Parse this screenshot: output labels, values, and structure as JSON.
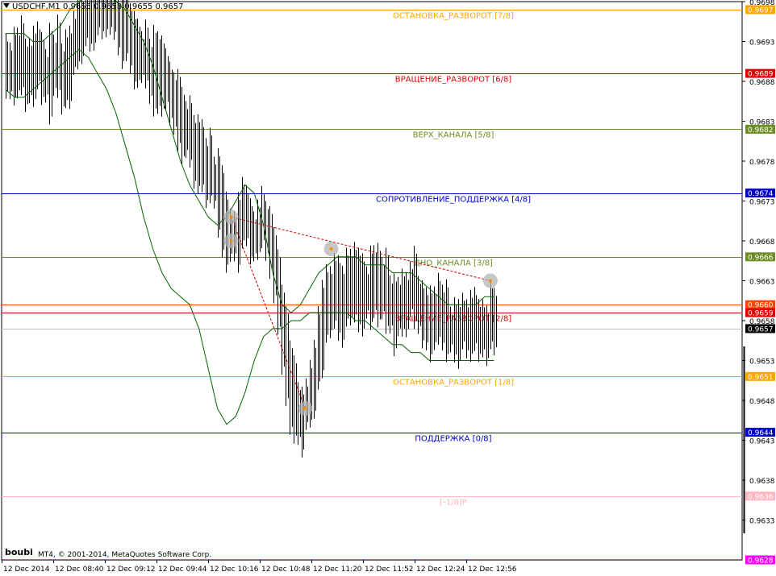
{
  "header": {
    "symbol_info": "USDCHF,M1  0.9655 0.9658 0.9655 0.9657"
  },
  "footer": {
    "user": "boubi",
    "copyright": "MT4, © 2001-2014, MetaQuotes Software Corp."
  },
  "colors": {
    "candle": "#000000",
    "bollinger": "#006400",
    "trendline": "#cc0000",
    "axis": "#000000",
    "grid_text": "#000000",
    "marker": "#b4b4b4"
  },
  "chart_data": {
    "type": "candlestick",
    "title": "USDCHF,M1",
    "ohlc_header": [
      "0.9655",
      "0.9658",
      "0.9655",
      "0.9657"
    ],
    "ylim": [
      0.9628,
      0.9698
    ],
    "price_ticks": [
      "0.9698",
      "0.9693",
      "0.9688",
      "0.9683",
      "0.9678",
      "0.9673",
      "0.9668",
      "0.9663",
      "0.9658",
      "0.9653",
      "0.9648",
      "0.9643",
      "0.9638",
      "0.9633"
    ],
    "time_ticks": [
      "12 Dec 2014",
      "12 Dec 08:40",
      "12 Dec 09:12",
      "12 Dec 09:44",
      "12 Dec 10:16",
      "12 Dec 10:48",
      "12 Dec 11:20",
      "12 Dec 11:52",
      "12 Dec 12:24",
      "12 Dec 12:56"
    ],
    "current_price": {
      "value": 0.9657,
      "label": "0.9657"
    },
    "levels": [
      {
        "name": "ОСТАНОВКА_РАЗВОРОТ [7/8]",
        "value": 0.9697,
        "label": "0.9697",
        "color": "#ffa500"
      },
      {
        "name": "ВРАЩЕНИЕ_РАЗВОРОТ [6/8]",
        "value": 0.9689,
        "label": "0.9689",
        "color": "#e00000"
      },
      {
        "name": "ВЕРХ_КАНАЛА [5/8]",
        "value": 0.9682,
        "label": "0.9682",
        "color": "#6b8e23"
      },
      {
        "name": "СОПРОТИВЛЕНИЕ_ПОДДЕРЖКА [4/8]",
        "value": 0.9674,
        "label": "0.9674",
        "color": "#0000cd"
      },
      {
        "name": "ДНО_КАНАЛА [3/8]",
        "value": 0.9666,
        "label": "0.9666",
        "color": "#6b8e23"
      },
      {
        "name": "",
        "value": 0.966,
        "label": "0.9660",
        "color": "#ff4500"
      },
      {
        "name": "ВРАЩЕНИЕ_РАЗВОРОТ [2/8]",
        "value": 0.9659,
        "label": "0.9659",
        "color": "#e00000"
      },
      {
        "name": "ОСТАНОВКА_РАЗВОРОТ [1/8]",
        "value": 0.9651,
        "label": "0.9651",
        "color": "#ffa500"
      },
      {
        "name": "ПОДДЕРЖКА [0/8]",
        "value": 0.9644,
        "label": "0.9644",
        "color": "#0000cd"
      },
      {
        "name": "[-1/8]P",
        "value": 0.9636,
        "label": "0.9636",
        "color": "#ffb6c1"
      },
      {
        "name": "",
        "value": 0.9628,
        "label": "0.9628",
        "color": "#ff00ff"
      }
    ],
    "price_line": [
      0.969,
      0.9689,
      0.9691,
      0.9692,
      0.969,
      0.9689,
      0.9688,
      0.9691,
      0.969,
      0.9689,
      0.9688,
      0.969,
      0.9691,
      0.9689,
      0.9688,
      0.969,
      0.9692,
      0.9693,
      0.9695,
      0.9696,
      0.9697,
      0.9697,
      0.9698,
      0.9697,
      0.9698,
      0.9698,
      0.9697,
      0.9696,
      0.9695,
      0.9694,
      0.9694,
      0.9693,
      0.9692,
      0.9691,
      0.9691,
      0.969,
      0.969,
      0.9689,
      0.9689,
      0.9688,
      0.9687,
      0.9686,
      0.9685,
      0.9684,
      0.9683,
      0.9682,
      0.9681,
      0.968,
      0.9679,
      0.9678,
      0.9677,
      0.9676,
      0.9675,
      0.9673,
      0.9671,
      0.9669,
      0.9668,
      0.9669,
      0.967,
      0.9671,
      0.967,
      0.9669,
      0.9669,
      0.967,
      0.967,
      0.9668,
      0.9666,
      0.9663,
      0.966,
      0.9656,
      0.9652,
      0.9649,
      0.9647,
      0.9646,
      0.9647,
      0.9648,
      0.965,
      0.9653,
      0.9656,
      0.9659,
      0.9661,
      0.9662,
      0.9661,
      0.966,
      0.9661,
      0.9662,
      0.9663,
      0.9663,
      0.9662,
      0.9661,
      0.9661,
      0.9662,
      0.9663,
      0.9662,
      0.9662,
      0.9661,
      0.966,
      0.9659,
      0.9659,
      0.966,
      0.9661,
      0.9662,
      0.9661,
      0.966,
      0.9659,
      0.9659,
      0.9658,
      0.9658,
      0.9659,
      0.9658,
      0.9657,
      0.9657,
      0.9656,
      0.9657,
      0.9658,
      0.9658,
      0.9657,
      0.9657,
      0.9656,
      0.9657,
      0.9657,
      0.9658,
      0.9657
    ],
    "bollinger_upper": [
      0.9694,
      0.9694,
      0.9694,
      0.9693,
      0.9693,
      0.9694,
      0.9695,
      0.9697,
      0.9698,
      0.9699,
      0.9699,
      0.9699,
      0.9698,
      0.9697,
      0.9695,
      0.9693,
      0.969,
      0.9686,
      0.9682,
      0.9678,
      0.9675,
      0.9673,
      0.9671,
      0.967,
      0.9671,
      0.9673,
      0.9675,
      0.9674,
      0.967,
      0.9664,
      0.966,
      0.9659,
      0.966,
      0.9662,
      0.9664,
      0.9665,
      0.9666,
      0.9666,
      0.9666,
      0.9665,
      0.9665,
      0.9665,
      0.9664,
      0.9664,
      0.9664,
      0.9663,
      0.9662,
      0.9661,
      0.966,
      0.966,
      0.966,
      0.966,
      0.9661,
      0.9661
    ],
    "bollinger_lower": [
      0.9687,
      0.9686,
      0.9686,
      0.9687,
      0.9688,
      0.9689,
      0.969,
      0.9691,
      0.9692,
      0.9691,
      0.9689,
      0.9687,
      0.9684,
      0.968,
      0.9676,
      0.9671,
      0.9667,
      0.9664,
      0.9662,
      0.9661,
      0.966,
      0.9657,
      0.9652,
      0.9647,
      0.9645,
      0.9646,
      0.9649,
      0.9653,
      0.9656,
      0.9657,
      0.9657,
      0.9658,
      0.9658,
      0.9659,
      0.9659,
      0.9659,
      0.9659,
      0.9659,
      0.9658,
      0.9658,
      0.9657,
      0.9656,
      0.9655,
      0.9655,
      0.9654,
      0.9654,
      0.9653,
      0.9653,
      0.9653,
      0.9653,
      0.9653,
      0.9653,
      0.9653,
      0.9653
    ],
    "trendline_upper": [
      {
        "t": 0.31,
        "p": 0.9671
      },
      {
        "t": 0.66,
        "p": 0.9663
      }
    ],
    "trendline_lower": [
      {
        "t": 0.31,
        "p": 0.9671
      },
      {
        "t": 0.41,
        "p": 0.9647
      }
    ]
  }
}
